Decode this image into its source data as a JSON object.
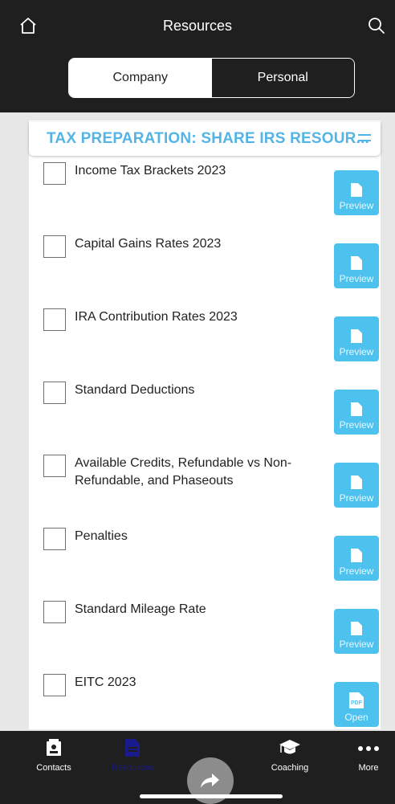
{
  "header": {
    "title": "Resources",
    "home_icon": "home-icon",
    "search_icon": "search-icon"
  },
  "segments": [
    {
      "label": "Company",
      "active": true
    },
    {
      "label": "Personal",
      "active": false
    }
  ],
  "section": {
    "title": "TAX PREPARATION: SHARE IRS RESOUR...",
    "accent_color": "#55b4e6"
  },
  "resources": [
    {
      "label": "Income Tax Brackets 2023",
      "action": "Preview",
      "checked": false
    },
    {
      "label": "Capital Gains Rates 2023",
      "action": "Preview",
      "checked": false
    },
    {
      "label": "IRA Contribution Rates 2023",
      "action": "Preview",
      "checked": false
    },
    {
      "label": "Standard Deductions",
      "action": "Preview",
      "checked": false
    },
    {
      "label": "Available Credits, Refundable vs Non-Refundable, and Phaseouts",
      "action": "Preview",
      "checked": false
    },
    {
      "label": "Penalties",
      "action": "Preview",
      "checked": false
    },
    {
      "label": "Standard Mileage Rate",
      "action": "Preview",
      "checked": false
    },
    {
      "label": "EITC 2023",
      "action": "Open",
      "action_icon": "pdf-icon",
      "checked": false
    }
  ],
  "nav": {
    "items": [
      {
        "label": "Contacts",
        "icon": "contacts-icon",
        "active": false
      },
      {
        "label": "Resources",
        "icon": "document-icon",
        "active": true
      },
      {
        "label": "Coaching",
        "icon": "graduation-cap-icon",
        "active": false
      },
      {
        "label": "More",
        "icon": "more-icon",
        "active": false
      }
    ],
    "share_icon": "share-icon"
  },
  "colors": {
    "bar": "#1f1f1f",
    "action_button": "#4dc2ef",
    "active_nav": "#1a1a8c"
  }
}
